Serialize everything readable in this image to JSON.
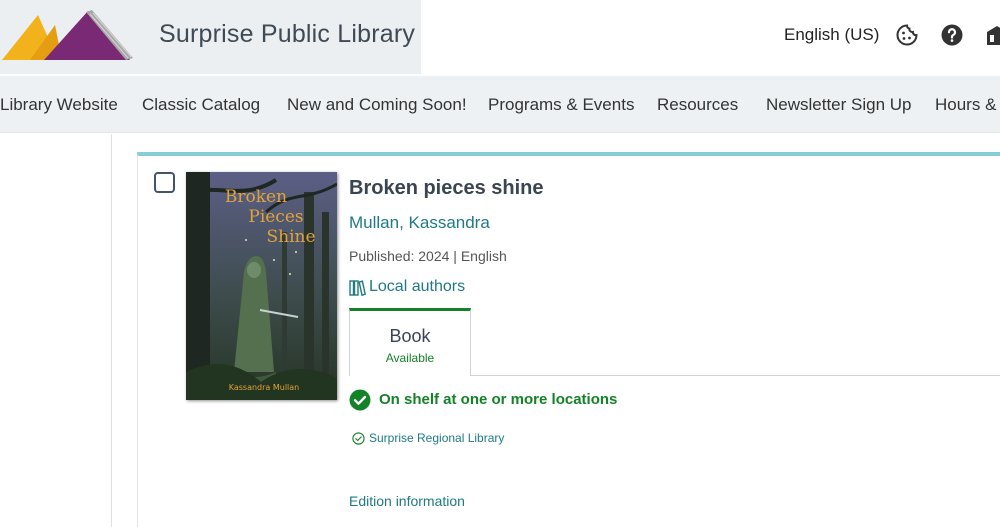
{
  "header": {
    "library_name": "Surprise Public Library",
    "language": "English (US)",
    "icons": [
      "cookie-icon",
      "help-icon",
      "library-building-icon"
    ]
  },
  "nav": {
    "items": [
      "Library Website",
      "Classic Catalog",
      "New and Coming Soon!",
      "Programs & Events",
      "Resources",
      "Newsletter Sign Up",
      "Hours & L"
    ]
  },
  "result": {
    "title": "Broken pieces shine",
    "author": "Mullan, Kassandra",
    "published": "Published: 2024 | English",
    "series": "Local authors",
    "cover": {
      "title_lines": [
        "Broken",
        "Pieces",
        "Shine"
      ],
      "author": "Kassandra Mullan"
    },
    "format": {
      "label": "Book",
      "status": "Available"
    },
    "availability": "On shelf at one or more locations",
    "location": "Surprise Regional Library",
    "edition_link": "Edition information"
  },
  "colors": {
    "accent_teal": "#1f7a85",
    "available_green": "#148228",
    "card_top_border": "#86cdd6",
    "nav_background": "#eef1f4",
    "brand_background": "#eceff1"
  }
}
